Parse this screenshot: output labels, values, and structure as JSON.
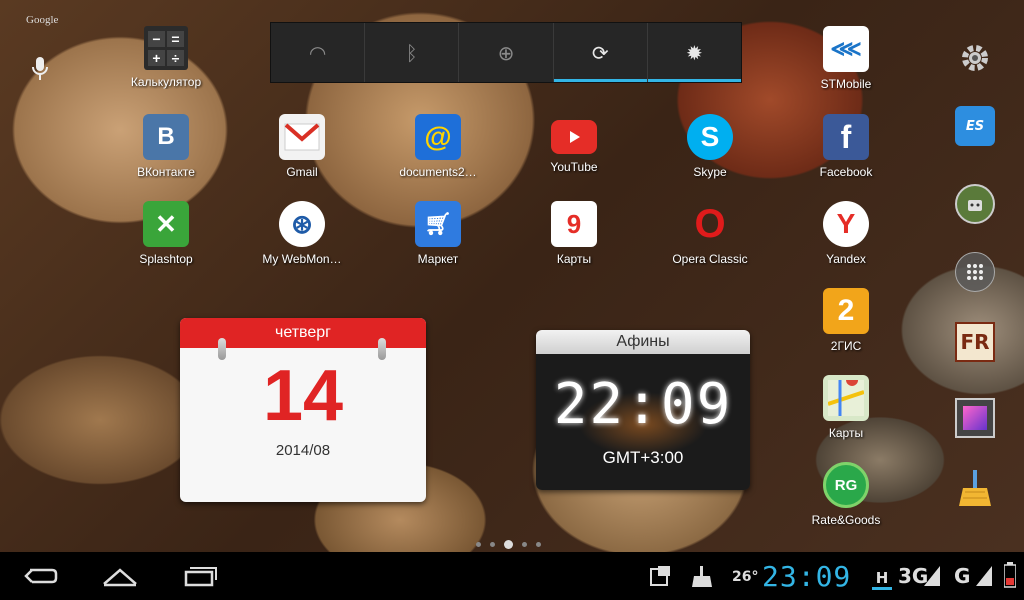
{
  "google_label": "Google",
  "quick_settings": {
    "tiles": [
      {
        "icon": "wifi-icon",
        "glyph": "◠"
      },
      {
        "icon": "bluetooth-icon",
        "glyph": "ᛒ"
      },
      {
        "icon": "gps-icon",
        "glyph": "⊕"
      },
      {
        "icon": "sync-icon",
        "glyph": "⟳"
      },
      {
        "icon": "brightness-icon",
        "glyph": "✹"
      }
    ],
    "accent": "#33b5e5"
  },
  "apps": {
    "calculator": "Калькулятор",
    "stmobile": "STMobile",
    "vkontakte": "ВКонтакте",
    "gmail": "Gmail",
    "documents": "documents2…",
    "youtube": "YouTube",
    "skype": "Skype",
    "facebook": "Facebook",
    "splashtop": "Splashtop",
    "webmoney": "My WebMon…",
    "market": "Маркет",
    "maps_yandex": "Карты",
    "opera": "Opera Classic",
    "yandex": "Yandex",
    "gis": "2ГИС",
    "maps_google": "Карты",
    "rategoods": "Rate&Goods"
  },
  "icon_glyphs": {
    "vk": "В",
    "mail": "@",
    "opera": "O",
    "yandex": "Y",
    "gis": "2",
    "rg": "RG",
    "fr": "FR",
    "es": "ES"
  },
  "calendar": {
    "weekday": "четверг",
    "day": "14",
    "year_month": "2014/08"
  },
  "clock_widget": {
    "city": "Афины",
    "time": "22:09",
    "timezone": "GMT+3:00"
  },
  "page_indicator": {
    "count": 5,
    "current": 2
  },
  "status": {
    "temperature": "26°",
    "time": "23:09",
    "net1_label": "H",
    "net2_label": "3G",
    "net3_label": "G"
  },
  "colors": {
    "calendar_red": "#e02424",
    "clock_digits": "#ffffff",
    "status_time": "#33b5e5"
  }
}
